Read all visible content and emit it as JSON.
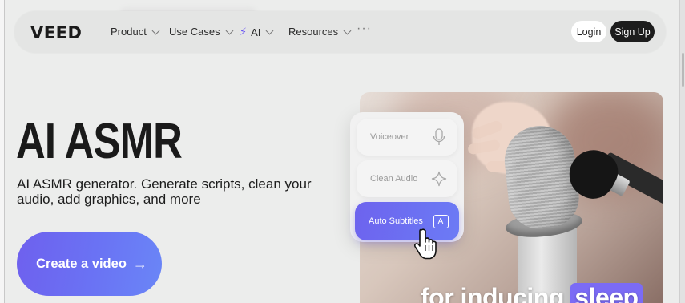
{
  "nav": {
    "logo": "VEED",
    "menu": [
      {
        "label": "Product"
      },
      {
        "label": "Use Cases"
      },
      {
        "label": "AI"
      },
      {
        "label": "Resources"
      }
    ],
    "more": "···",
    "login": "Login",
    "signup": "Sign Up"
  },
  "hero": {
    "title": "AI ASMR",
    "subtitle": "AI ASMR generator. Generate scripts, clean your audio, add graphics, and more",
    "cta": "Create a video",
    "cta_arrow": "→"
  },
  "feature_card": {
    "items": [
      {
        "label": "Voiceover",
        "icon": "microphone-icon"
      },
      {
        "label": "Clean Audio",
        "icon": "sparkle-icon"
      },
      {
        "label": "Auto Subtitles",
        "icon": "subtitle-box-a-icon",
        "icon_text": "A"
      }
    ]
  },
  "media": {
    "caption_plain": "for inducing",
    "caption_highlight": "sleep"
  },
  "colors": {
    "accent": "#6e60ee",
    "dark": "#1d1d1d",
    "background": "#ecedec"
  }
}
